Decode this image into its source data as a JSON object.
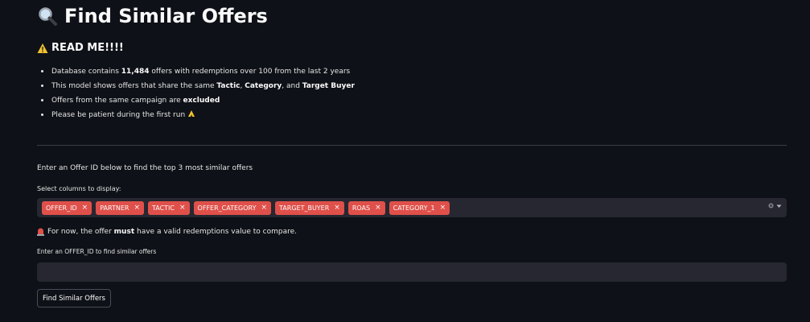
{
  "header": {
    "title": "Find Similar Offers",
    "title_icon": "magnifying-glass-icon"
  },
  "readme": {
    "heading": "READ ME!!!!",
    "heading_icon": "warning-icon",
    "bullets": [
      {
        "pre": "Database contains ",
        "bold": "11,484",
        "post": " offers with redemptions over 100 from the last 2 years"
      },
      {
        "pre": "This model shows offers that share the same ",
        "bold1": "Tactic",
        "mid1": ", ",
        "bold2": "Category",
        "mid2": ", and ",
        "bold3": "Target Buyer"
      },
      {
        "pre": "Offers from the same campaign are ",
        "bold": "excluded"
      },
      {
        "pre": "Please be patient during the first run",
        "icon": "praying-hands-icon"
      }
    ]
  },
  "main": {
    "intro": "Enter an Offer ID below to find the top 3 most similar offers",
    "columns_label": "Select columns to display:",
    "selected_columns": [
      "OFFER_ID",
      "PARTNER",
      "TACTIC",
      "OFFER_CATEGORY",
      "TARGET_BUYER",
      "ROAS",
      "CATEGORY_1"
    ],
    "note_pre": "For now, the offer ",
    "note_bold": "must",
    "note_post": " have a valid redemptions value to compare.",
    "note_icon": "siren-icon",
    "input_label": "Enter an OFFER_ID to find similar offers",
    "input_value": "",
    "button_label": "Find Similar Offers"
  },
  "colors": {
    "background": "#0e1117",
    "tag": "#e0504a",
    "input_bg": "#262730"
  }
}
